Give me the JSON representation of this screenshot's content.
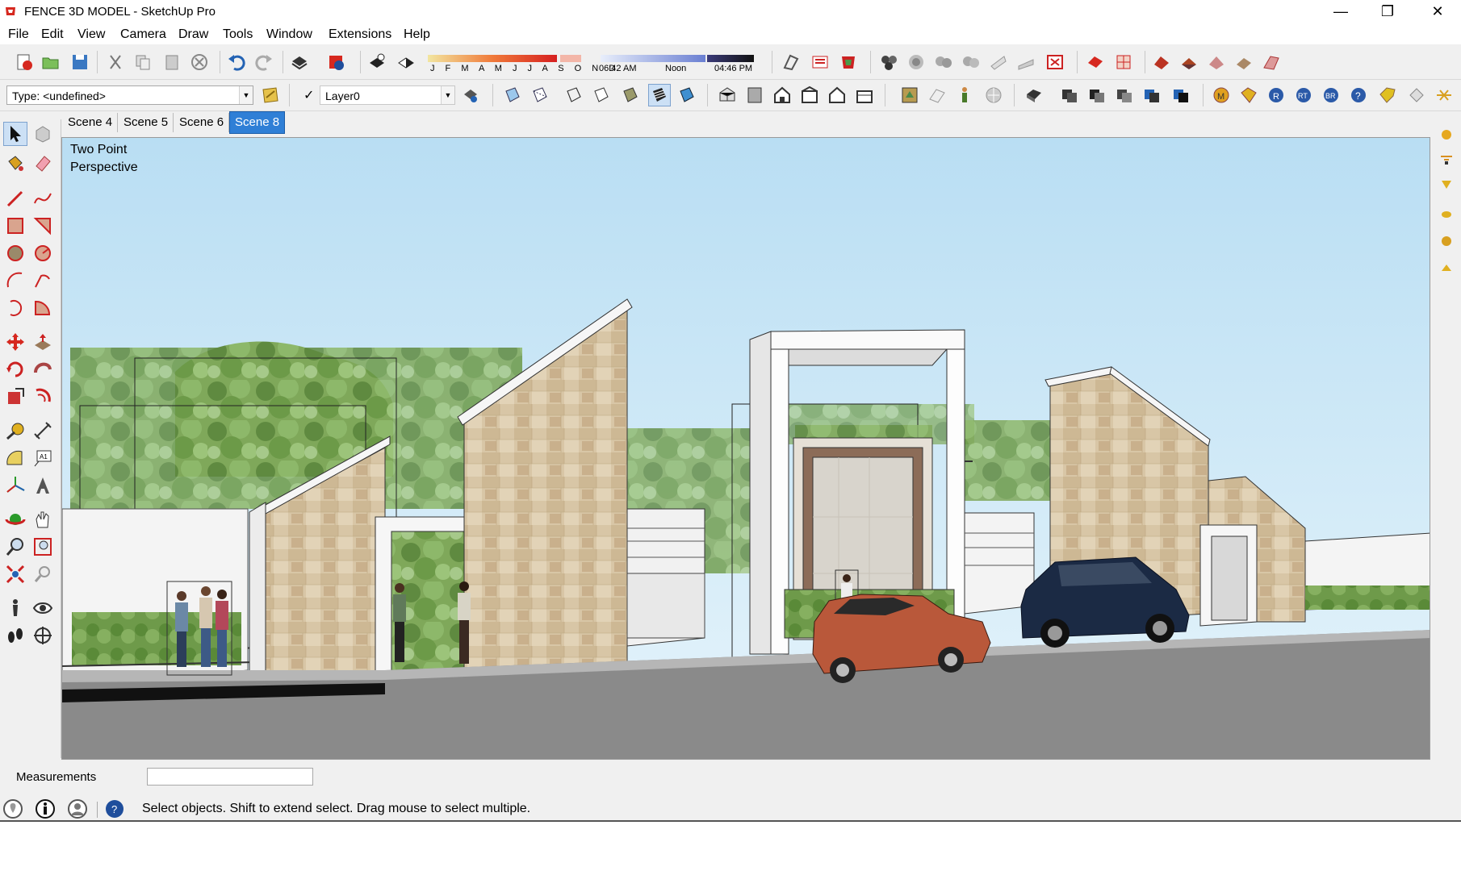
{
  "window": {
    "title": "FENCE 3D MODEL - SketchUp Pro",
    "minimize": "—",
    "restore": "❐",
    "close": "✕"
  },
  "menu": [
    "File",
    "Edit",
    "View",
    "Camera",
    "Draw",
    "Tools",
    "Window",
    "Extensions",
    "Help"
  ],
  "toolbar": {
    "type_combo": "Type: <undefined>",
    "layer_check": "✓",
    "layer_combo": "Layer0",
    "months": "J F M A M J J A S O N D",
    "time_start": "06:42 AM",
    "time_mid": "Noon",
    "time_end": "04:46 PM"
  },
  "scenes": [
    "Scene 4",
    "Scene 5",
    "Scene 6",
    "Scene 8"
  ],
  "active_scene": "Scene 8",
  "viewport": {
    "camera_line1": "Two Point",
    "camera_line2": "Perspective"
  },
  "statusbar": {
    "measurements_label": "Measurements",
    "measurements_value": "",
    "status_text": "Select objects. Shift to extend select. Drag mouse to select multiple."
  },
  "colors": {
    "accent": "#2f7fd6",
    "sky_top": "#b9def3",
    "sky_bottom": "#e6f4fb",
    "stone": "#d8c6a6",
    "road": "#8a8a8a",
    "car_orange": "#b9583a",
    "car_navy": "#1b2a44"
  }
}
